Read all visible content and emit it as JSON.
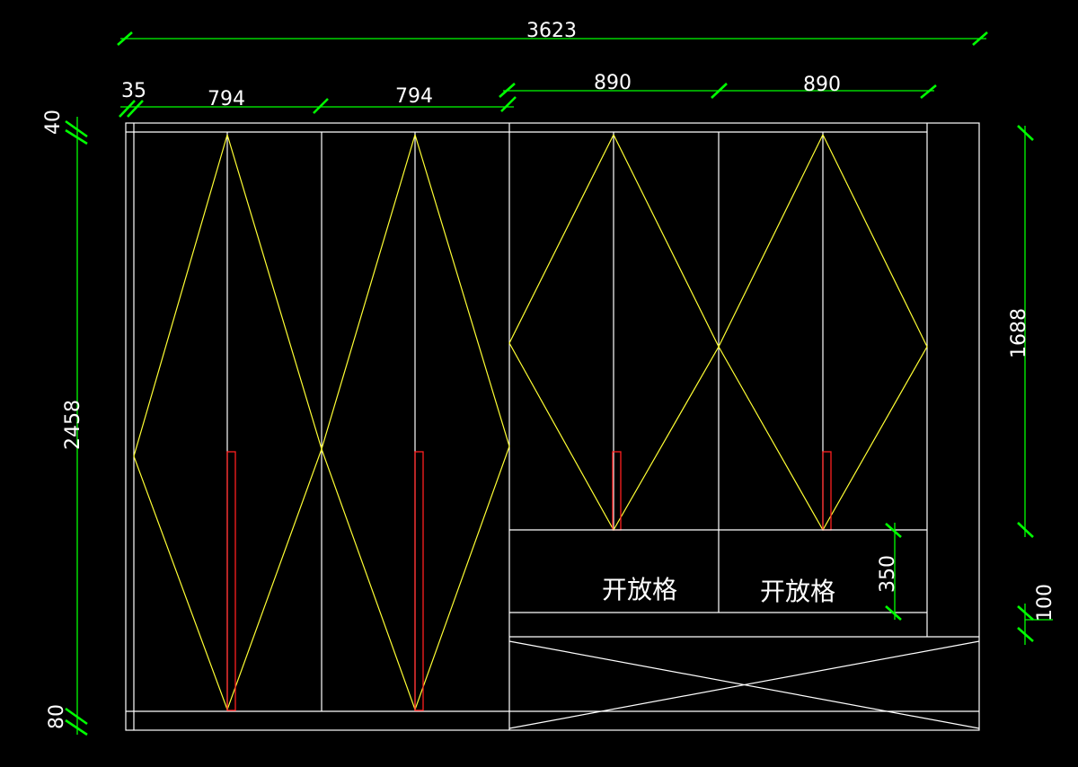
{
  "dimensions": {
    "total_width": "3623",
    "side_panel": "35",
    "door_width_1": "794",
    "door_width_2": "794",
    "door_width_3": "890",
    "door_width_4": "890",
    "top_height": "40",
    "total_height": "2458",
    "bottom_height": "80",
    "upper_cabinet_height": "1688",
    "open_shelf_height": "350",
    "gap_height": "100"
  },
  "labels": {
    "open_shelf_1": "开放格",
    "open_shelf_2": "开放格"
  },
  "colors": {
    "background": "#000000",
    "outline": "#ffffff",
    "door_pattern": "#ffff33",
    "handle": "#ff2020",
    "dimension": "#00ff00"
  }
}
